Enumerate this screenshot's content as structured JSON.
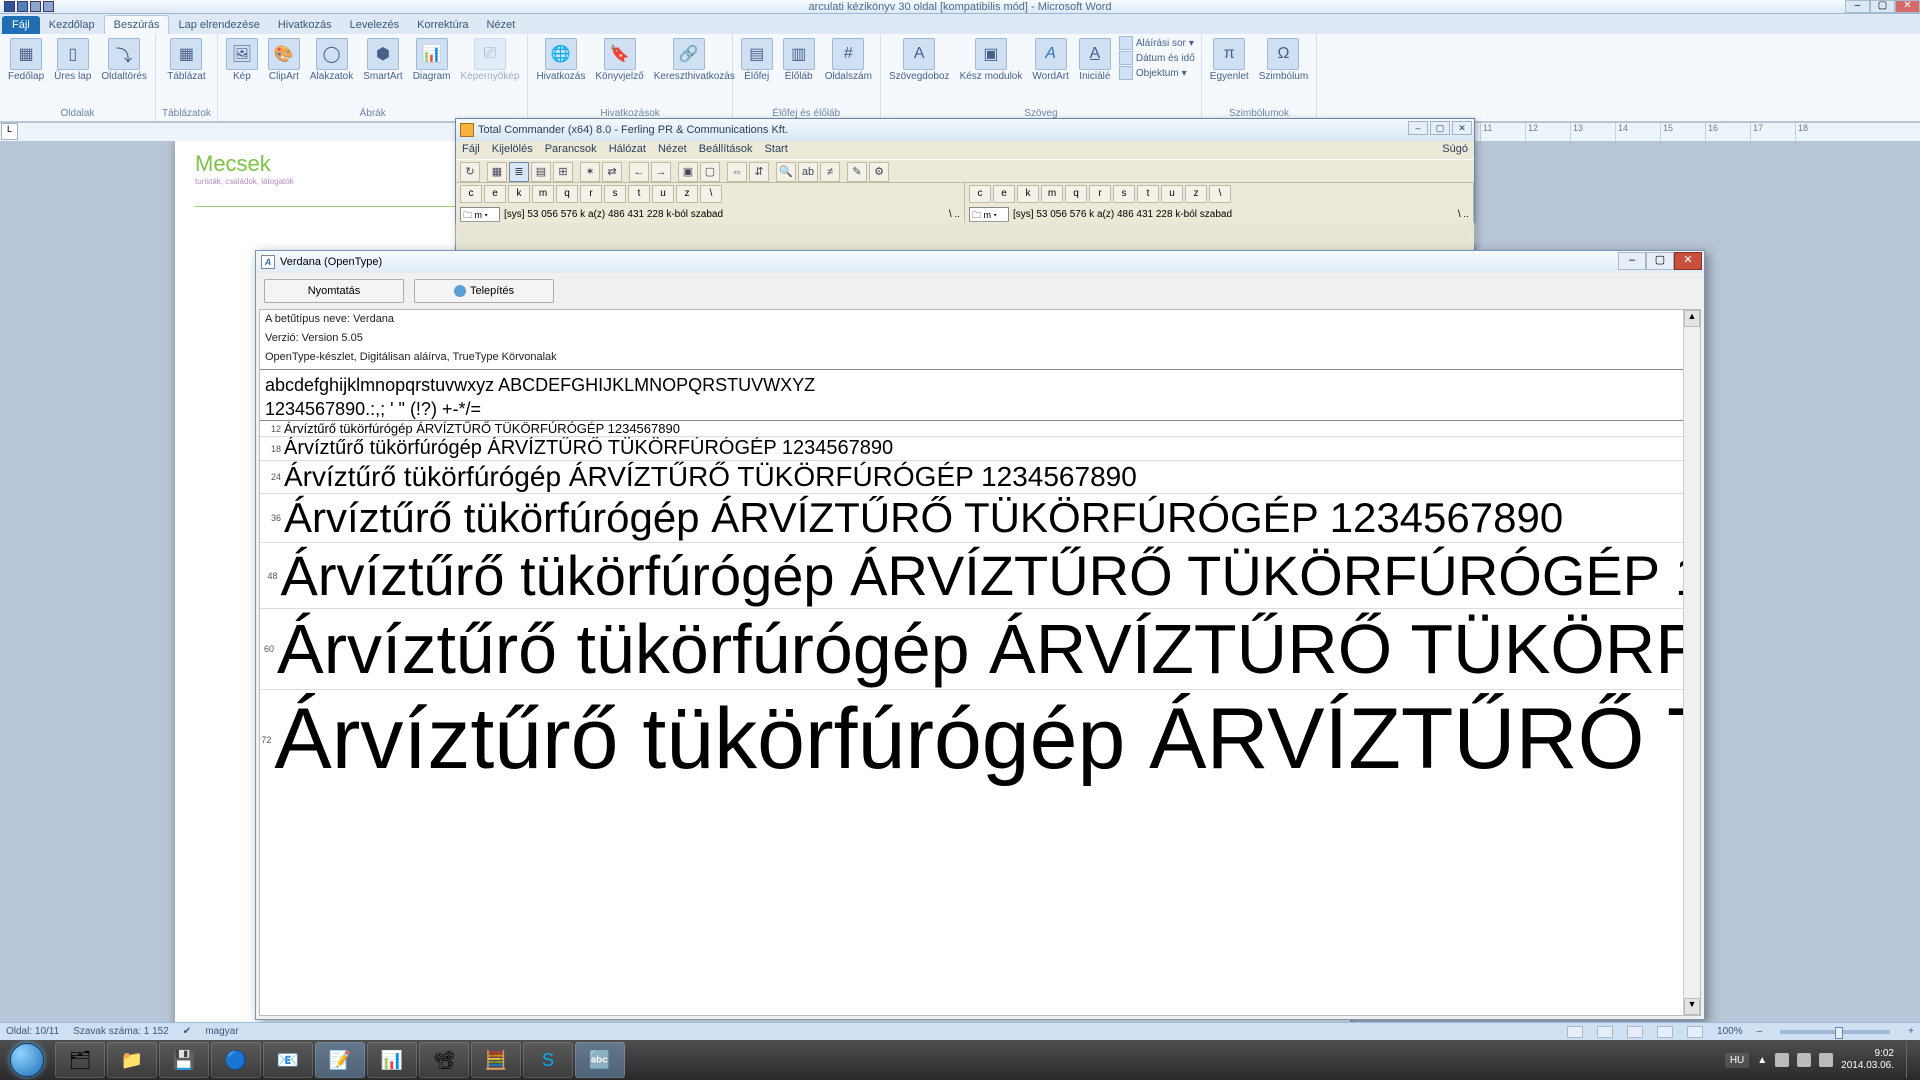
{
  "word": {
    "title": "arculati kézikönyv 30 oldal [kompatibilis mód] - Microsoft Word",
    "tabs": {
      "file": "Fájl",
      "home": "Kezdőlap",
      "insert": "Beszúrás",
      "layout": "Lap elrendezése",
      "refs": "Hivatkozás",
      "mail": "Levelezés",
      "review": "Korrektúra",
      "view": "Nézet"
    },
    "groups": {
      "pages": {
        "name": "Oldalak",
        "cover": "Fedőlap",
        "blank": "Üres lap",
        "break": "Oldaltörés"
      },
      "tables": {
        "name": "Táblázatok",
        "table": "Táblázat"
      },
      "illus": {
        "name": "Ábrák",
        "pic": "Kép",
        "clip": "ClipArt",
        "shapes": "Alakzatok",
        "smart": "SmartArt",
        "chart": "Diagram",
        "screen": "Képernyőkép"
      },
      "links": {
        "name": "Hivatkozások",
        "link": "Hivatkozás",
        "book": "Könyvjelző",
        "cross": "Kereszthivatkozás"
      },
      "header": {
        "name": "Élőfej és élőláb",
        "head": "Élőfej",
        "foot": "Élőláb",
        "num": "Oldalszám"
      },
      "text": {
        "name": "Szöveg",
        "box": "Szövegdoboz",
        "quick": "Kész modulok",
        "wa": "WordArt",
        "drop": "Iniciálé",
        "sig": "Aláírási sor",
        "dt": "Dátum és idő",
        "obj": "Objektum"
      },
      "sym": {
        "name": "Szimbólumok",
        "eq": "Egyenlet",
        "sym": "Szimbólum"
      }
    },
    "ruler_marks": [
      "11",
      "12",
      "13",
      "14",
      "15",
      "16",
      "17",
      "18"
    ],
    "status": {
      "page": "Oldal: 10/11",
      "words": "Szavak száma: 1 152",
      "lang": "magyar",
      "zoom": "100%"
    },
    "logo": {
      "name": "Mecsek",
      "sub": "turisták, családok, látogatók"
    }
  },
  "tc": {
    "title": "Total Commander (x64) 8.0 - Ferling PR & Communications Kft.",
    "menu": [
      "Fájl",
      "Kijelölés",
      "Parancsok",
      "Hálózat",
      "Nézet",
      "Beállítások",
      "Start"
    ],
    "help": "Súgó",
    "drives": [
      "c",
      "e",
      "k",
      "m",
      "q",
      "r",
      "s",
      "t",
      "u",
      "z"
    ],
    "drive_sel": "m",
    "freespace": "[sys]  53 056 576 k a(z) 486 431 228 k-ból szabad"
  },
  "fv": {
    "title": "Verdana (OpenType)",
    "print": "Nyomtatás",
    "install": "Telepítés",
    "meta1": "A betűtípus neve: Verdana",
    "meta2": "Verzió: Version 5.05",
    "meta3": "OpenType-készlet, Digitálisan aláírva, TrueType Körvonalak",
    "alpha1": "abcdefghijklmnopqrstuvwxyz ABCDEFGHIJKLMNOPQRSTUVWXYZ",
    "alpha2": "1234567890.:,; ' \" (!?) +-*/=",
    "sample": "Árvíztűrő tükörfúrógép ÁRVÍZTŰRŐ TÜKÖRFÚRÓGÉP 1234567890",
    "sizes": [
      "12",
      "18",
      "24",
      "36",
      "48",
      "60",
      "72"
    ]
  },
  "taskbar": {
    "lang": "HU",
    "time": "9:02",
    "date": "2014.03.06."
  }
}
